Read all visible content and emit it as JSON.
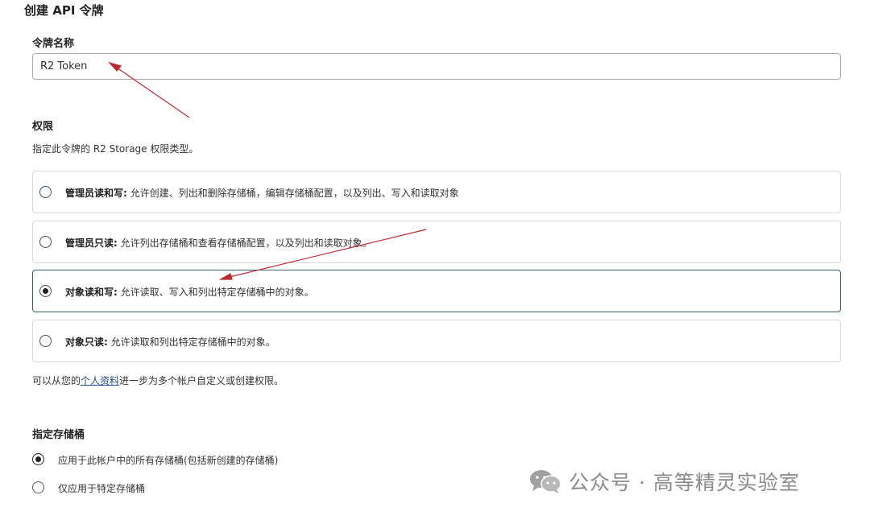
{
  "page_title": "创建 API 令牌",
  "token_name": {
    "label": "令牌名称",
    "value": "R2 Token"
  },
  "permissions": {
    "title": "权限",
    "description": "指定此令牌的 R2 Storage 权限类型。",
    "options": [
      {
        "name": "管理员读和写:",
        "desc": " 允许创建、列出和删除存储桶，编辑存储桶配置，以及列出、写入和读取对象",
        "selected": false
      },
      {
        "name": "管理员只读:",
        "desc": " 允许列出存储桶和查看存储桶配置，以及列出和读取对象。",
        "selected": false
      },
      {
        "name": "对象读和写:",
        "desc": " 允许读取、写入和列出特定存储桶中的对象。",
        "selected": true
      },
      {
        "name": "对象只读:",
        "desc": " 允许读取和列出特定存储桶中的对象。",
        "selected": false
      }
    ],
    "footnote_prefix": "可以从您的",
    "footnote_link": "个人资料",
    "footnote_suffix": "进一步为多个帐户自定义或创建权限。"
  },
  "buckets": {
    "title": "指定存储桶",
    "options": [
      {
        "label": "应用于此帐户中的所有存储桶(包括新创建的存储桶)",
        "selected": true
      },
      {
        "label": "仅应用于特定存储桶",
        "selected": false
      }
    ]
  },
  "watermark": {
    "text": "公众号 · 高等精灵实验室",
    "icon": "wechat-icon"
  },
  "colors": {
    "annotation_arrow": "#c0282d",
    "selected_border": "#3a5f7d",
    "link": "#1f4e8c"
  }
}
